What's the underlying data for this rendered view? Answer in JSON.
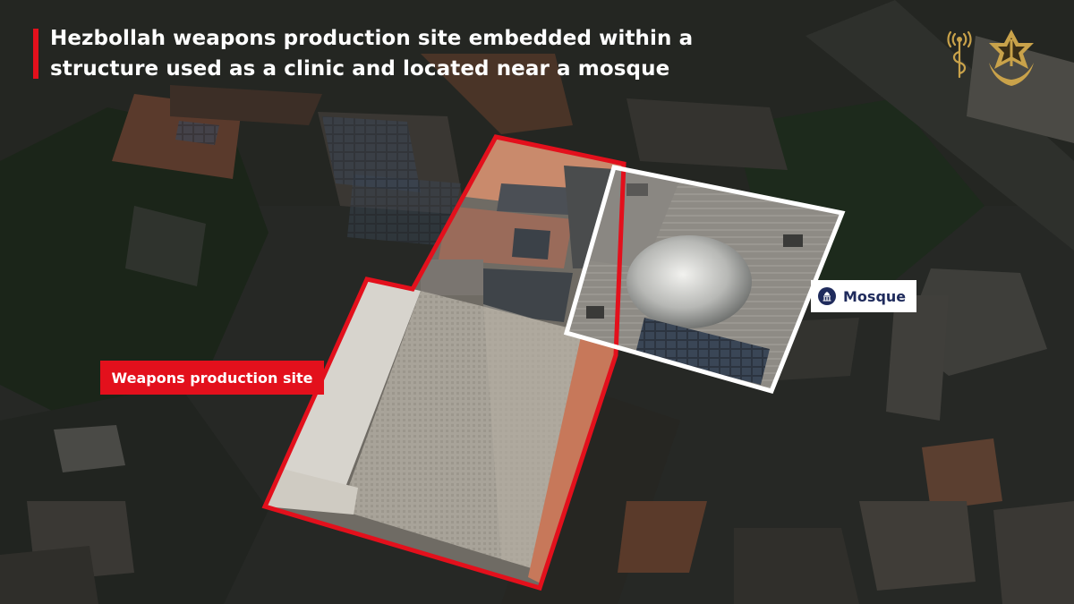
{
  "header": {
    "title": "Hezbollah weapons production site embedded within a structure used as a clinic and located near a mosque"
  },
  "labels": {
    "weapons_site": "Weapons production site",
    "mosque": "Mosque"
  },
  "colors": {
    "accent_red": "#e3101c",
    "mosque_outline": "#ffffff",
    "mosque_label_text": "#1f2b5c",
    "logo_gold": "#c9a24a"
  },
  "icons": {
    "mosque": "mosque-icon",
    "unit_emblem": "unit-emblem-icon",
    "idf_emblem": "idf-emblem-icon"
  }
}
